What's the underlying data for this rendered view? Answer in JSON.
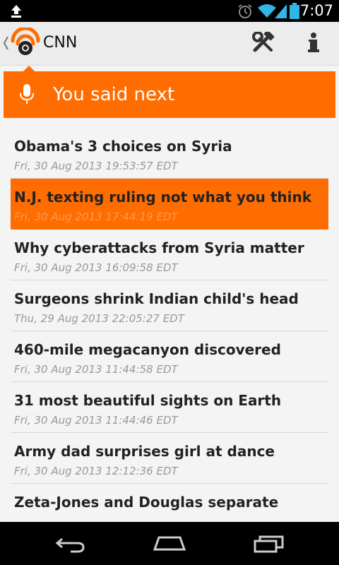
{
  "status_bar": {
    "time": "7:07",
    "icons": [
      "upload-icon",
      "alarm-icon",
      "wifi-icon",
      "signal-icon",
      "battery-icon"
    ]
  },
  "action_bar": {
    "title": "CNN",
    "icons": [
      "up-caret-icon",
      "rss-logo-icon",
      "tools-icon",
      "info-icon"
    ]
  },
  "voice_banner": {
    "text": "You said next",
    "icon": "microphone-icon"
  },
  "news": [
    {
      "headline": "Obama's 3 choices on Syria",
      "date": "Fri, 30 Aug 2013 19:53:57 EDT",
      "selected": false
    },
    {
      "headline": "N.J. texting ruling not what you think",
      "date": "Fri, 30 Aug 2013 17:44:19 EDT",
      "selected": true
    },
    {
      "headline": "Why cyberattacks from Syria matter",
      "date": "Fri, 30 Aug 2013 16:09:58 EDT",
      "selected": false
    },
    {
      "headline": "Surgeons shrink Indian child's head",
      "date": "Thu, 29 Aug 2013 22:05:27 EDT",
      "selected": false
    },
    {
      "headline": "460-mile megacanyon discovered",
      "date": "Fri, 30 Aug 2013 11:44:58 EDT",
      "selected": false
    },
    {
      "headline": "31 most beautiful sights on Earth",
      "date": "Fri, 30 Aug 2013 11:44:46 EDT",
      "selected": false
    },
    {
      "headline": "Army dad surprises girl at dance",
      "date": "Fri, 30 Aug 2013 12:12:36 EDT",
      "selected": false
    },
    {
      "headline": "Zeta-Jones and Douglas separate",
      "date": "",
      "selected": false
    }
  ],
  "nav_bar": {
    "icons": [
      "back-icon",
      "home-icon",
      "recent-apps-icon"
    ]
  },
  "colors": {
    "accent": "#ff6c00",
    "action_bar_bg": "#ececec",
    "status_icons": "#33b5e5"
  }
}
